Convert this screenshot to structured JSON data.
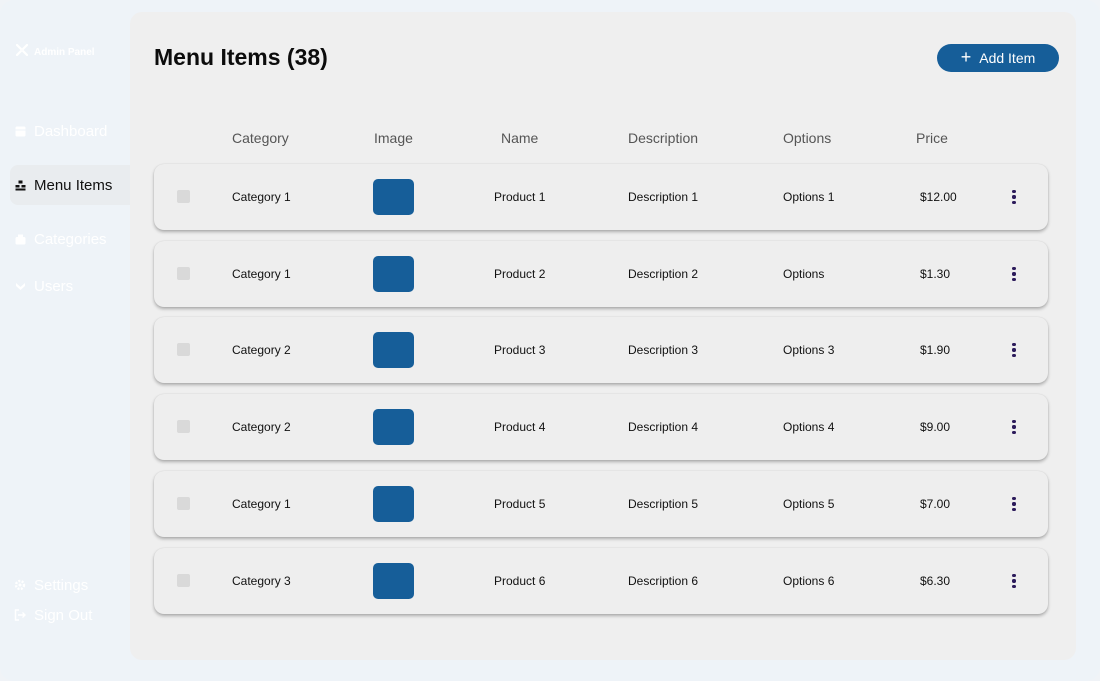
{
  "app": {
    "brand": "Admin Panel"
  },
  "sidebar": {
    "items": [
      {
        "label": "Dashboard",
        "icon": "dashboard-icon"
      },
      {
        "label": "Menu Items",
        "icon": "menu-items-icon",
        "active": true
      },
      {
        "label": "Categories",
        "icon": "categories-icon"
      },
      {
        "label": "Users",
        "icon": "users-icon"
      }
    ],
    "footer": [
      {
        "label": "Settings",
        "icon": "gear-icon"
      },
      {
        "label": "Sign Out",
        "icon": "sign-out-icon"
      }
    ]
  },
  "page": {
    "title": "Menu Items (38)",
    "add_button": "Add Item"
  },
  "table": {
    "columns": [
      "Category",
      "Image",
      "Name",
      "Description",
      "Options",
      "Price"
    ],
    "rows": [
      {
        "category": "Category 1",
        "name": "Product 1",
        "description": "Description 1",
        "options": "Options 1",
        "price": "$12.00"
      },
      {
        "category": "Category 1",
        "name": "Product 2",
        "description": "Description 2",
        "options": "Options",
        "price": "$1.30"
      },
      {
        "category": "Category 2",
        "name": "Product 3",
        "description": "Description 3",
        "options": "Options 3",
        "price": "$1.90"
      },
      {
        "category": "Category 2",
        "name": "Product 4",
        "description": "Description 4",
        "options": "Options 4",
        "price": "$9.00"
      },
      {
        "category": "Category 1",
        "name": "Product 5",
        "description": "Description 5",
        "options": "Options 5",
        "price": "$7.00"
      },
      {
        "category": "Category 3",
        "name": "Product 6",
        "description": "Description 6",
        "options": "Options 6",
        "price": "$6.30"
      }
    ]
  },
  "colors": {
    "accent": "#165e99",
    "more_dots": "#2b1a5a",
    "panel": "#efefef",
    "background": "#eef3f8"
  }
}
